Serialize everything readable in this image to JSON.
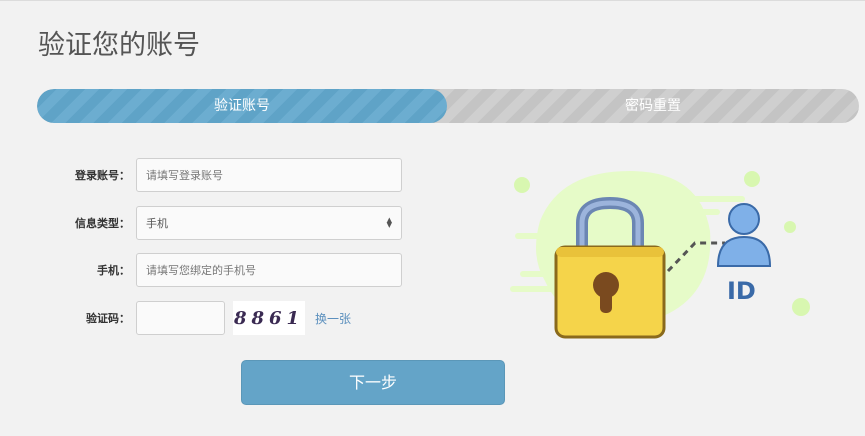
{
  "page": {
    "title": "验证您的账号"
  },
  "steps": [
    {
      "label": "验证账号",
      "active": true
    },
    {
      "label": "密码重置",
      "active": false
    }
  ],
  "form": {
    "account": {
      "label": "登录账号：",
      "placeholder": "请填写登录账号"
    },
    "info_type": {
      "label": "信息类型：",
      "value": "手机"
    },
    "phone": {
      "label": "手机：",
      "placeholder": "请填写您绑定的手机号"
    },
    "captcha": {
      "label": "验证码：",
      "image_text": "8861",
      "refresh_label": "换一张"
    },
    "submit_label": "下一步"
  },
  "illustration": {
    "id_text": "ID"
  },
  "colors": {
    "accent": "#64a4c8",
    "step_inactive": "#c8c8c8",
    "link": "#5a8fbd",
    "lock": "#f2cf45"
  }
}
